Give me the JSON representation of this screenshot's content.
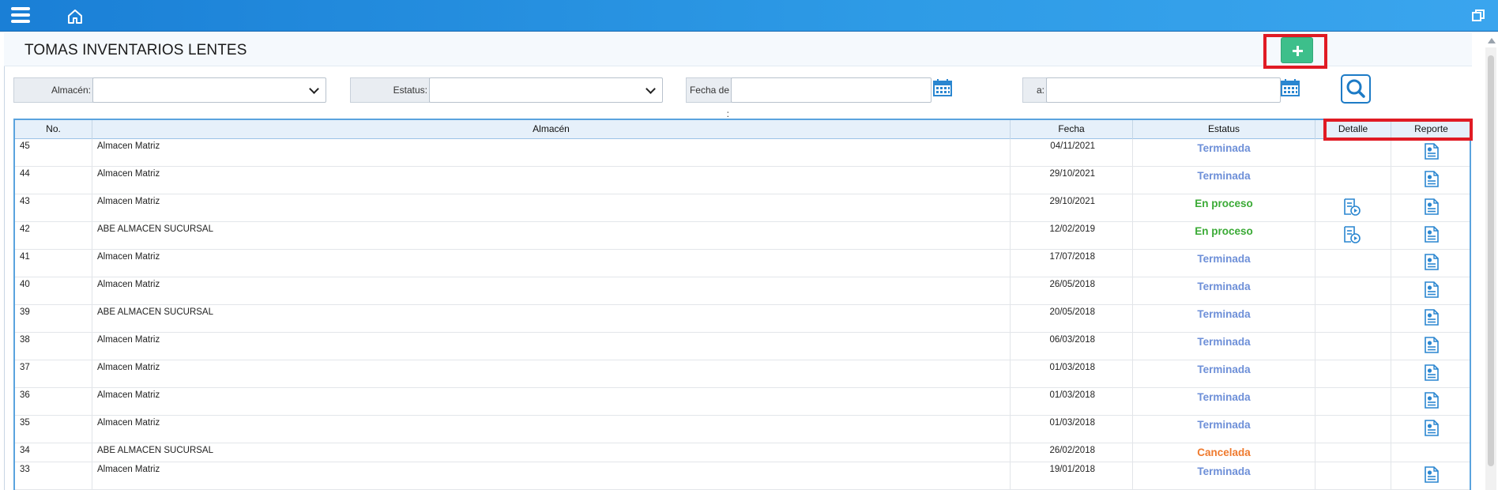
{
  "header": {
    "menu_icon": "hamburger-menu-icon",
    "home_icon": "home-icon",
    "restore_icon": "restore-window-icon",
    "bar_color": "#2e9be6"
  },
  "page": {
    "title": "TOMAS INVENTARIOS LENTES",
    "add_button_icon": "plus-icon",
    "add_button_color": "#3dbf8b",
    "highlight_color": "#e01b24"
  },
  "filters": {
    "almacen_label": "Almacén:",
    "almacen_value": "",
    "estatus_label": "Estatus:",
    "estatus_value": "",
    "fecha_de_label": "Fecha de :",
    "fecha_de_value": "",
    "a_label": "a:",
    "a_value": "",
    "calendar_icon": "calendar-icon",
    "search_icon": "search-icon"
  },
  "table": {
    "columns": [
      "No.",
      "Almacén",
      "Fecha",
      "Estatus",
      "Detalle",
      "Reporte"
    ],
    "rows": [
      {
        "no": "45",
        "almacen": "Almacen Matriz",
        "fecha": "04/11/2021",
        "estatus": "Terminada",
        "detalle": false,
        "reporte": true
      },
      {
        "no": "44",
        "almacen": "Almacen Matriz",
        "fecha": "29/10/2021",
        "estatus": "Terminada",
        "detalle": false,
        "reporte": true
      },
      {
        "no": "43",
        "almacen": "Almacen Matriz",
        "fecha": "29/10/2021",
        "estatus": "En proceso",
        "detalle": true,
        "reporte": true
      },
      {
        "no": "42",
        "almacen": "ABE ALMACEN SUCURSAL",
        "fecha": "12/02/2019",
        "estatus": "En proceso",
        "detalle": true,
        "reporte": true
      },
      {
        "no": "41",
        "almacen": "Almacen Matriz",
        "fecha": "17/07/2018",
        "estatus": "Terminada",
        "detalle": false,
        "reporte": true
      },
      {
        "no": "40",
        "almacen": "Almacen Matriz",
        "fecha": "26/05/2018",
        "estatus": "Terminada",
        "detalle": false,
        "reporte": true
      },
      {
        "no": "39",
        "almacen": "ABE ALMACEN SUCURSAL",
        "fecha": "20/05/2018",
        "estatus": "Terminada",
        "detalle": false,
        "reporte": true
      },
      {
        "no": "38",
        "almacen": "Almacen Matriz",
        "fecha": "06/03/2018",
        "estatus": "Terminada",
        "detalle": false,
        "reporte": true
      },
      {
        "no": "37",
        "almacen": "Almacen Matriz",
        "fecha": "01/03/2018",
        "estatus": "Terminada",
        "detalle": false,
        "reporte": true
      },
      {
        "no": "36",
        "almacen": "Almacen Matriz",
        "fecha": "01/03/2018",
        "estatus": "Terminada",
        "detalle": false,
        "reporte": true
      },
      {
        "no": "35",
        "almacen": "Almacen Matriz",
        "fecha": "01/03/2018",
        "estatus": "Terminada",
        "detalle": false,
        "reporte": true
      },
      {
        "no": "34",
        "almacen": "ABE ALMACEN SUCURSAL",
        "fecha": "26/02/2018",
        "estatus": "Cancelada",
        "detalle": false,
        "reporte": false
      },
      {
        "no": "33",
        "almacen": "Almacen Matriz",
        "fecha": "19/01/2018",
        "estatus": "Terminada",
        "detalle": false,
        "reporte": true
      }
    ],
    "status_colors": {
      "Terminada": "#6d8fd8",
      "En proceso": "#3aaa35",
      "Cancelada": "#ef7a2e"
    },
    "detalle_icon": "document-play-icon",
    "reporte_icon": "report-document-icon"
  }
}
